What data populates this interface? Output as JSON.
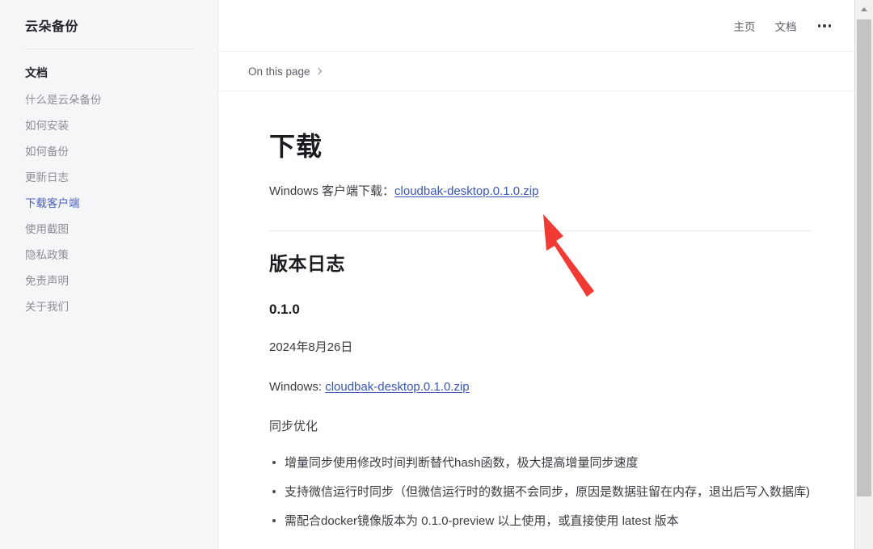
{
  "sidebar": {
    "brand": "云朵备份",
    "section_title": "文档",
    "items": [
      {
        "label": "什么是云朵备份",
        "active": false
      },
      {
        "label": "如何安装",
        "active": false
      },
      {
        "label": "如何备份",
        "active": false
      },
      {
        "label": "更新日志",
        "active": false
      },
      {
        "label": "下载客户端",
        "active": true
      },
      {
        "label": "使用截图",
        "active": false
      },
      {
        "label": "隐私政策",
        "active": false
      },
      {
        "label": "免责声明",
        "active": false
      },
      {
        "label": "关于我们",
        "active": false
      }
    ]
  },
  "topnav": {
    "home": "主页",
    "docs": "文档",
    "more_icon": "ellipsis-icon"
  },
  "breadcrumb": {
    "label": "On this page",
    "chevron_icon": "chevron-right-icon"
  },
  "main": {
    "title": "下载",
    "download_line_prefix": "Windows 客户端下载：",
    "download_link": "cloudbak-desktop.0.1.0.zip",
    "changelog_title": "版本日志",
    "version": "0.1.0",
    "date": "2024年8月26日",
    "windows_prefix": "Windows: ",
    "windows_link": "cloudbak-desktop.0.1.0.zip",
    "sync_heading": "同步优化",
    "bullets": [
      "增量同步使用修改时间判断替代hash函数，极大提高增量同步速度",
      "支持微信运行时同步（但微信运行时的数据不会同步，原因是数据驻留在内存，退出后写入数据库)",
      "需配合docker镜像版本为 0.1.0-preview 以上使用，或直接使用 latest 版本"
    ]
  },
  "annotation": {
    "type": "red-arrow",
    "color": "#f03a33",
    "points_to": "cloudbak-desktop.0.1.0.zip download link"
  },
  "scrollbar": {
    "up_arrow_icon": "scroll-up-arrow-icon"
  },
  "colors": {
    "accent_link": "#3b57b5",
    "sidebar_active": "#4a5fc1",
    "sidebar_bg": "#f5f6f7",
    "annotation_red": "#f03a33"
  }
}
